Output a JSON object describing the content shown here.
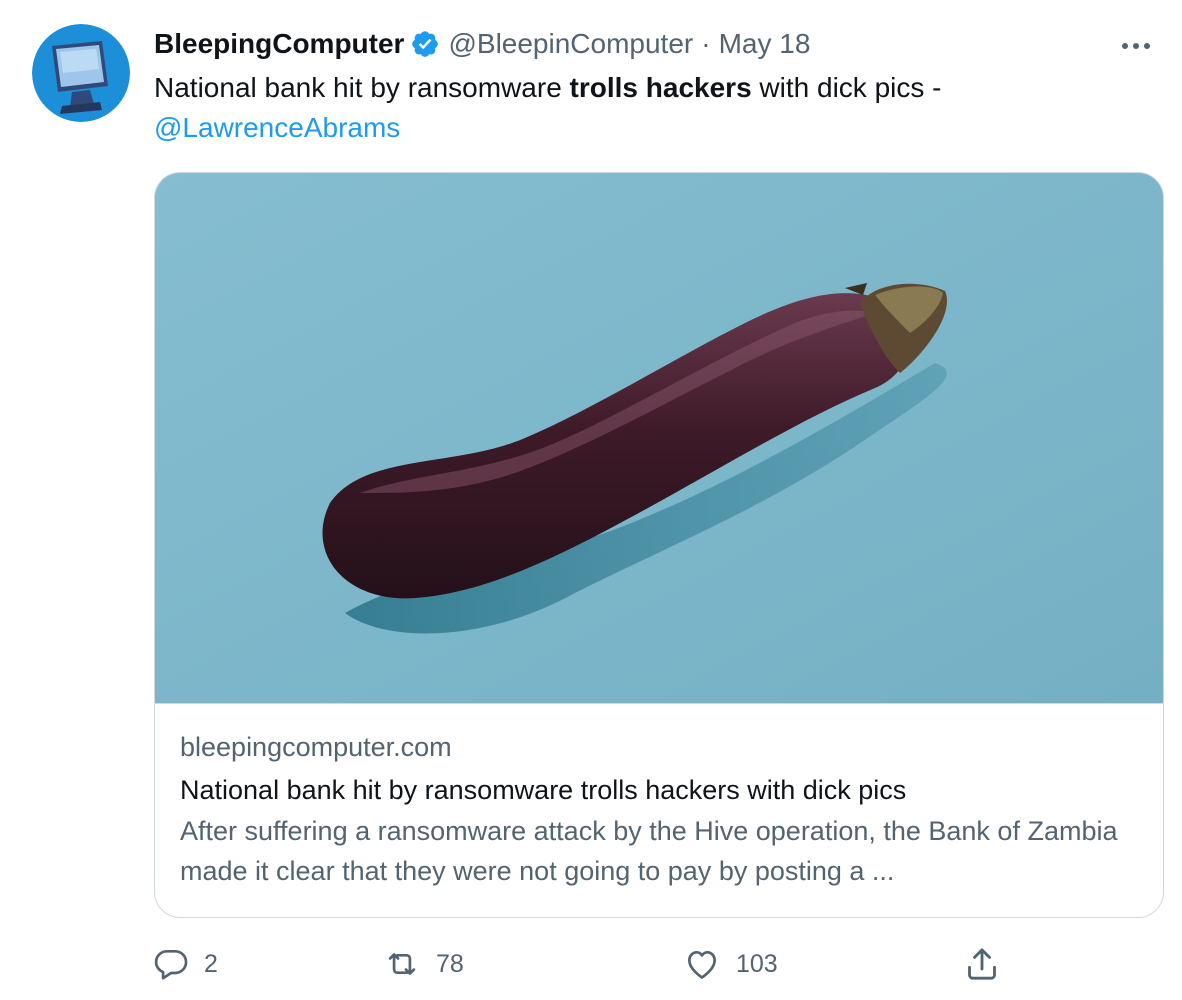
{
  "tweet": {
    "display_name": "BleepingComputer",
    "verified": true,
    "handle": "@BleepinComputer",
    "separator": "·",
    "date": "May 18",
    "text_part1": "National bank hit by ransomware ",
    "text_bold": "trolls hackers",
    "text_part2": " with dick pics - ",
    "mention": "@LawrenceAbrams"
  },
  "card": {
    "domain": "bleepingcomputer.com",
    "title": "National bank hit by ransomware trolls hackers with dick pics",
    "description": "After suffering a ransomware attack by the Hive operation, the Bank of Zambia made it clear that they were not going to pay by posting a ..."
  },
  "actions": {
    "replies": "2",
    "retweets": "78",
    "likes": "103"
  },
  "icons": {
    "avatar": "computer-monitor-avatar",
    "verified": "verified-badge-icon",
    "more": "more-dots-icon",
    "reply": "reply-icon",
    "retweet": "retweet-icon",
    "like": "heart-icon",
    "share": "share-icon"
  },
  "colors": {
    "accent": "#1d9bf0",
    "secondary_text": "#536471",
    "image_background": "#7fb8cc",
    "eggplant": "#4a1e2c"
  }
}
